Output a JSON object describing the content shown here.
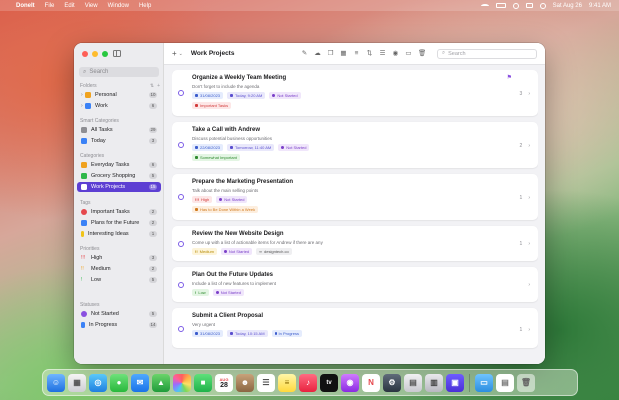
{
  "menubar": {
    "apple": "",
    "app_name": "DoneIt",
    "menus": [
      "File",
      "Edit",
      "View",
      "Window",
      "Help"
    ],
    "date": "Sat Aug 26",
    "time": "9:41 AM"
  },
  "sidebar": {
    "search_placeholder": "Search",
    "folders": {
      "header": "Folders",
      "items": [
        {
          "label": "Personal",
          "count": "10",
          "color": "#f0a21e"
        },
        {
          "label": "Work",
          "count": "6",
          "color": "#3b82f6"
        }
      ]
    },
    "smart": {
      "header": "Smart Categories",
      "items": [
        {
          "label": "All Tasks",
          "count": "29",
          "color": "#6e6e73"
        },
        {
          "label": "Today",
          "count": "3",
          "color": "#3b82f6"
        }
      ]
    },
    "categories": {
      "header": "Categories",
      "items": [
        {
          "label": "Everyday Tasks",
          "count": "6",
          "color": "#f0a21e"
        },
        {
          "label": "Grocery Shopping",
          "count": "5",
          "color": "#2fb84a"
        },
        {
          "label": "Work Projects",
          "count": "15",
          "color": "#8a50e0",
          "active": true
        }
      ]
    },
    "tags": {
      "header": "Tags",
      "items": [
        {
          "label": "Important Tasks",
          "count": "2",
          "color": "#e5484d"
        },
        {
          "label": "Plans for the Future",
          "count": "2",
          "color": "#3b82f6"
        },
        {
          "label": "Interesting Ideas",
          "count": "1",
          "color": "#f0c419"
        }
      ]
    },
    "priorities": {
      "header": "Priorities",
      "items": [
        {
          "label": "High",
          "count": "3",
          "color": "#e5484d"
        },
        {
          "label": "Medium",
          "count": "2",
          "color": "#f0a21e"
        },
        {
          "label": "Low",
          "count": "5",
          "color": "#2fb84a"
        }
      ]
    },
    "statuses": {
      "header": "Statuses",
      "items": [
        {
          "label": "Not Started",
          "count": "5",
          "color": "#8a50e0"
        },
        {
          "label": "In Progress",
          "count": "14",
          "color": "#3b82f6"
        }
      ]
    }
  },
  "toolbar": {
    "plus": "+",
    "title": "Work Projects",
    "search_placeholder": "Search"
  },
  "tasks": [
    {
      "title": "Organize a Weekly Team Meeting",
      "description": "Don't forget to include the agenda",
      "date": "31/08/2023",
      "time": "Today, 9:20 AM",
      "status": "Not Started",
      "tag": "Important Tasks",
      "count": "3"
    },
    {
      "title": "Take a Call with Andrew",
      "description": "Discuss potential business opportunities",
      "date": "22/08/2023",
      "time": "Tomorrow, 11:40 AM",
      "status": "Not Started",
      "tag": "Somewhat Important",
      "count": "2"
    },
    {
      "title": "Prepare the Marketing Presentation",
      "description": "Talk about the main selling points",
      "priority": "High",
      "status": "Not Started",
      "tag": "Has to Be Done Within a Week",
      "count": "1"
    },
    {
      "title": "Review the New Website Design",
      "description": "Come up with a list of actionable items for Andrew if there are any",
      "priority": "Medium",
      "status": "Not Started",
      "link": "designtech.co",
      "count": "1"
    },
    {
      "title": "Plan Out the Future Updates",
      "description": "Include a list of new features to implement",
      "priority": "Low",
      "status": "Not Started"
    },
    {
      "title": "Submit a Client Proposal",
      "description": "Very urgent",
      "date": "31/08/2023",
      "time": "Today, 10:15 AM",
      "status": "In Progress",
      "count": "1"
    }
  ],
  "dock": {
    "calendar_month": "AUG",
    "calendar_day": "28",
    "tv_label": "tv"
  }
}
